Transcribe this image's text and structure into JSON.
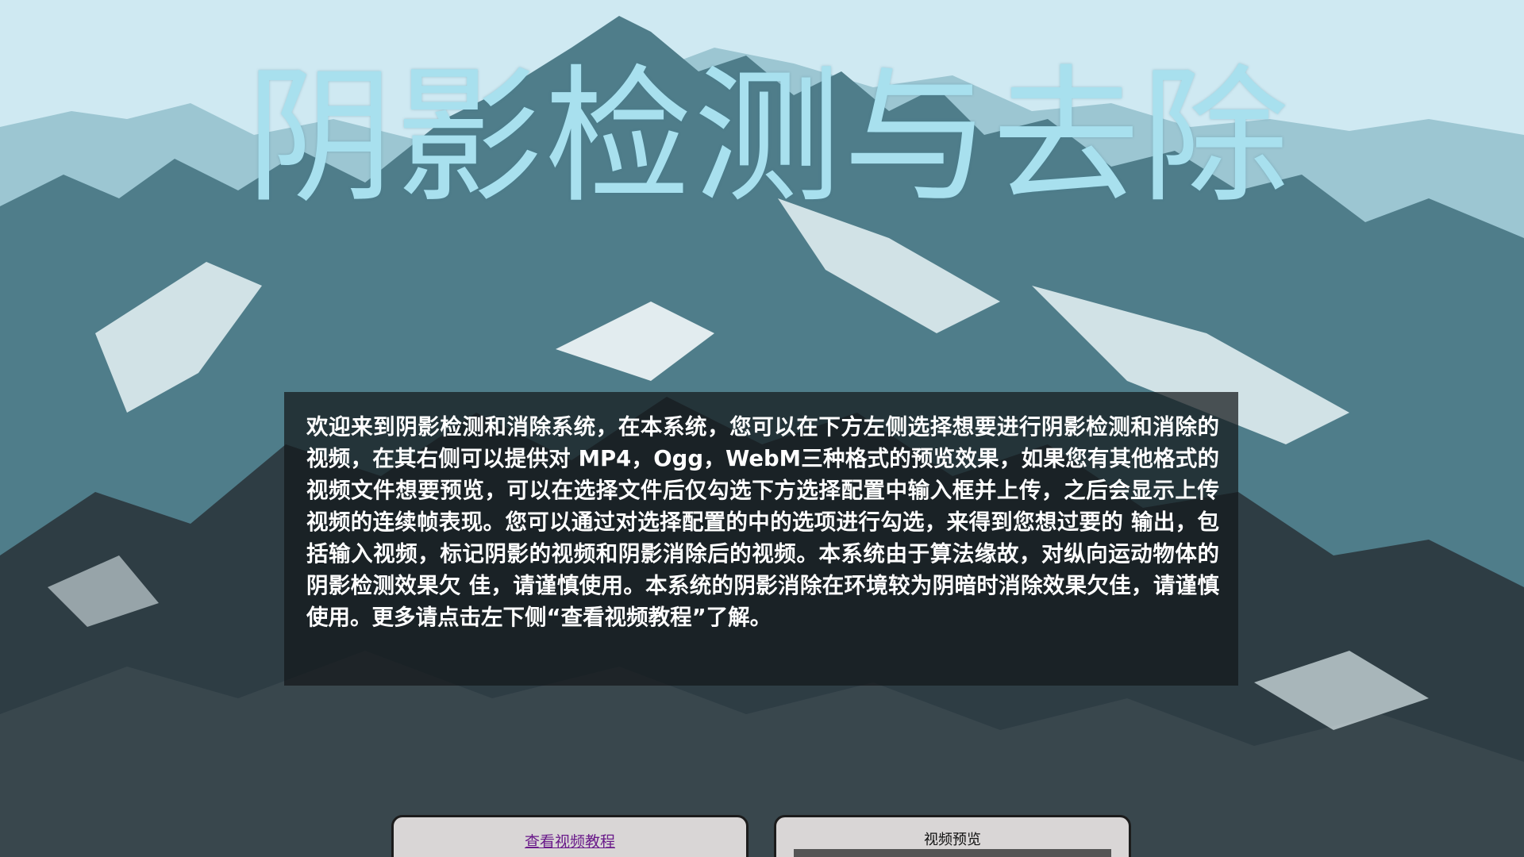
{
  "header": {
    "title": "阴影检测与去除"
  },
  "intro": {
    "text": "欢迎来到阴影检测和消除系统，在本系统，您可以在下方左侧选择想要进行阴影检测和消除的视频，在其右侧可以提供对 MP4，Ogg，WebM三种格式的预览效果，如果您有其他格式的视频文件想要预览，可以在选择文件后仅勾选下方选择配置中输入框并上传，之后会显示上传视频的连续帧表现。您可以通过对选择配置的中的选项进行勾选，来得到您想过要的 输出，包括输入视频，标记阴影的视频和阴影消除后的视频。本系统由于算法缘故，对纵向运动物体的阴影检测效果欠 佳，请谨慎使用。本系统的阴影消除在环境较为阴暗时消除效果欠佳，请谨慎使用。更多请点击左下侧“查看视频教程”了解。"
  },
  "panels": {
    "tutorial_link": "查看视频教程",
    "preview_label": "视频预览"
  },
  "colors": {
    "title": "#a8e0ee",
    "link": "#6a1b8a",
    "panel_bg": "#d9d6d6"
  }
}
